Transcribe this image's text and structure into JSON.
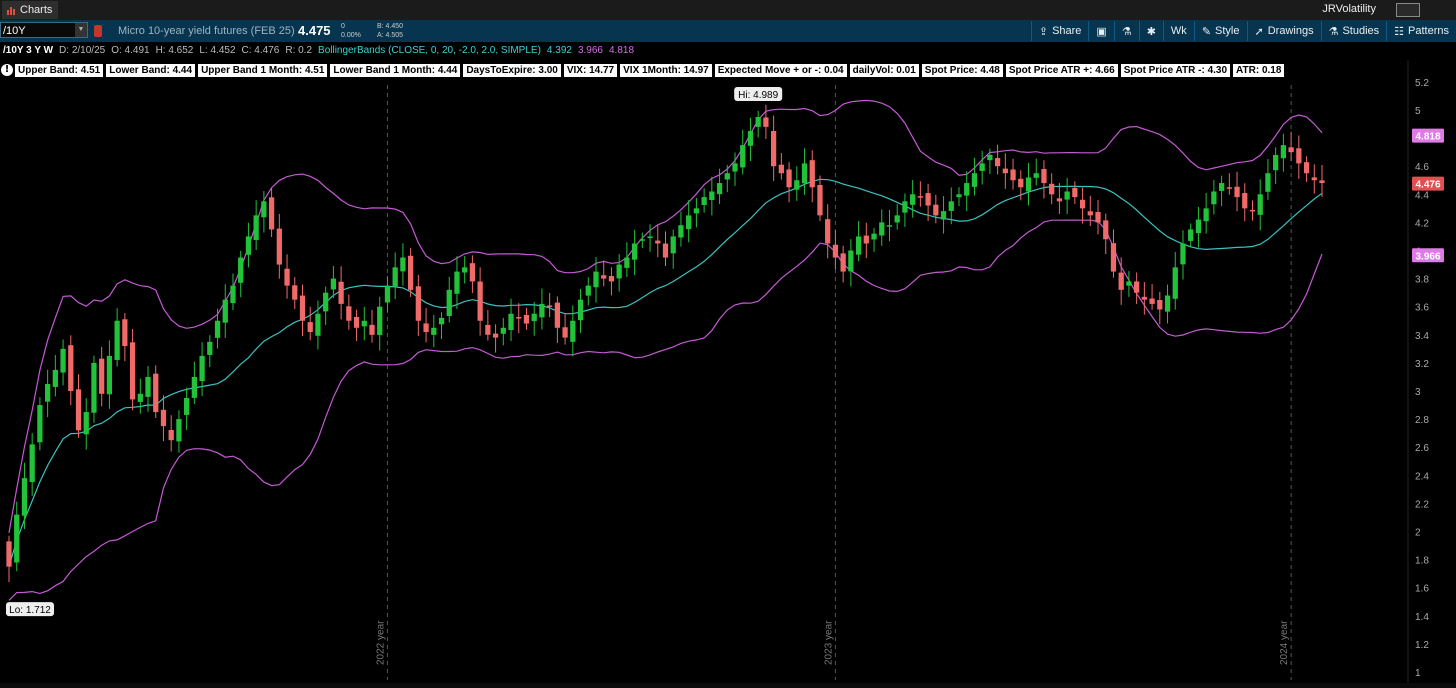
{
  "window": {
    "app_title": "Charts",
    "user": "JRVolatility"
  },
  "toolbar": {
    "symbol": "/10Y",
    "description": "Micro 10-year yield futures (FEB 25)",
    "last_price": "4.475",
    "change": "0",
    "change_pct": "0.00%",
    "bid": "B: 4.450",
    "ask": "A: 4.505",
    "buttons": {
      "share": "Share",
      "timeframe": "Wk",
      "style": "Style",
      "drawings": "Drawings",
      "studies": "Studies",
      "patterns": "Patterns"
    }
  },
  "infobar": {
    "symbol_period": "/10Y 3 Y W",
    "date": "D: 2/10/25",
    "open": "O: 4.491",
    "high": "H: 4.652",
    "low": "L: 4.452",
    "close": "C: 4.476",
    "range": "R: 0.2",
    "study": "BollingerBands (CLOSE, 0, 20, -2.0, 2.0, SIMPLE)",
    "bb_mid": "4.392",
    "bb_lower": "3.966",
    "bb_upper": "4.818"
  },
  "labels": [
    "Upper Band: 4.51",
    "Lower Band: 4.44",
    "Upper Band 1 Month: 4.51",
    "Lower Band 1 Month: 4.44",
    "DaysToExpire: 3.00",
    "VIX: 14.77",
    "VIX 1Month: 14.97",
    "Expected Move + or -: 0.04",
    "dailyVol: 0.01",
    "Spot Price: 4.48",
    "Spot Price ATR +: 4.66",
    "Spot Price ATR -: 4.30",
    "ATR: 0.18"
  ],
  "chart_data": {
    "type": "candlestick",
    "y_ticks": [
      "1",
      "1.2",
      "1.4",
      "1.6",
      "1.8",
      "2",
      "2.2",
      "2.4",
      "2.6",
      "2.8",
      "3",
      "3.2",
      "3.4",
      "3.6",
      "3.8",
      "4",
      "4.2",
      "4.4",
      "4.6",
      "4.8",
      "5",
      "5.2"
    ],
    "ylim": [
      1.0,
      5.25
    ],
    "year_markers": [
      "2022 year",
      "2023 year",
      "2024 year"
    ],
    "hi_label": "Hi: 4.989",
    "lo_label": "Lo: 1.712",
    "price_tags": [
      {
        "label": "4.818",
        "value": 4.818,
        "color": "#e07ae8"
      },
      {
        "label": "4.476",
        "value": 4.476,
        "color": "#e05050"
      },
      {
        "label": "3.966",
        "value": 3.966,
        "color": "#e07ae8"
      }
    ],
    "colors": {
      "up": "#22c23a",
      "down": "#f06a6a",
      "bb_band": "#c45ad4",
      "bb_mid": "#39c2c2",
      "grid_dash": "#555555"
    },
    "closes": [
      1.75,
      2.12,
      2.38,
      2.62,
      2.9,
      3.05,
      3.15,
      3.3,
      3.0,
      2.72,
      2.85,
      3.2,
      2.98,
      3.25,
      3.5,
      3.32,
      2.94,
      2.98,
      3.1,
      2.85,
      2.75,
      2.65,
      2.8,
      2.95,
      3.1,
      3.25,
      3.35,
      3.5,
      3.65,
      3.75,
      3.95,
      4.1,
      4.25,
      4.35,
      4.15,
      3.9,
      3.75,
      3.65,
      3.5,
      3.42,
      3.55,
      3.7,
      3.8,
      3.62,
      3.5,
      3.45,
      3.5,
      3.4,
      3.6,
      3.75,
      3.88,
      3.95,
      3.72,
      3.5,
      3.42,
      3.45,
      3.52,
      3.72,
      3.85,
      3.88,
      3.78,
      3.5,
      3.4,
      3.38,
      3.45,
      3.55,
      3.52,
      3.48,
      3.55,
      3.62,
      3.6,
      3.45,
      3.38,
      3.5,
      3.65,
      3.75,
      3.85,
      3.8,
      3.78,
      3.9,
      3.95,
      4.05,
      4.08,
      4.1,
      4.05,
      3.95,
      4.1,
      4.18,
      4.25,
      4.3,
      4.38,
      4.42,
      4.48,
      4.55,
      4.62,
      4.75,
      4.85,
      4.95,
      4.88,
      4.6,
      4.55,
      4.45,
      4.5,
      4.62,
      4.45,
      4.25,
      4.05,
      3.95,
      3.85,
      4.0,
      4.1,
      4.05,
      4.12,
      4.2,
      4.18,
      4.25,
      4.35,
      4.4,
      4.38,
      4.32,
      4.25,
      4.28,
      4.35,
      4.4,
      4.48,
      4.55,
      4.62,
      4.68,
      4.6,
      4.55,
      4.5,
      4.45,
      4.52,
      4.55,
      4.48,
      4.4,
      4.35,
      4.42,
      4.38,
      4.3,
      4.25,
      4.2,
      4.08,
      3.85,
      3.72,
      3.78,
      3.7,
      3.65,
      3.62,
      3.58,
      3.68,
      3.88,
      4.05,
      4.15,
      4.22,
      4.3,
      4.42,
      4.48,
      4.45,
      4.38,
      4.3,
      4.28,
      4.4,
      4.55,
      4.68,
      4.75,
      4.7,
      4.62,
      4.55,
      4.5,
      4.48
    ]
  }
}
